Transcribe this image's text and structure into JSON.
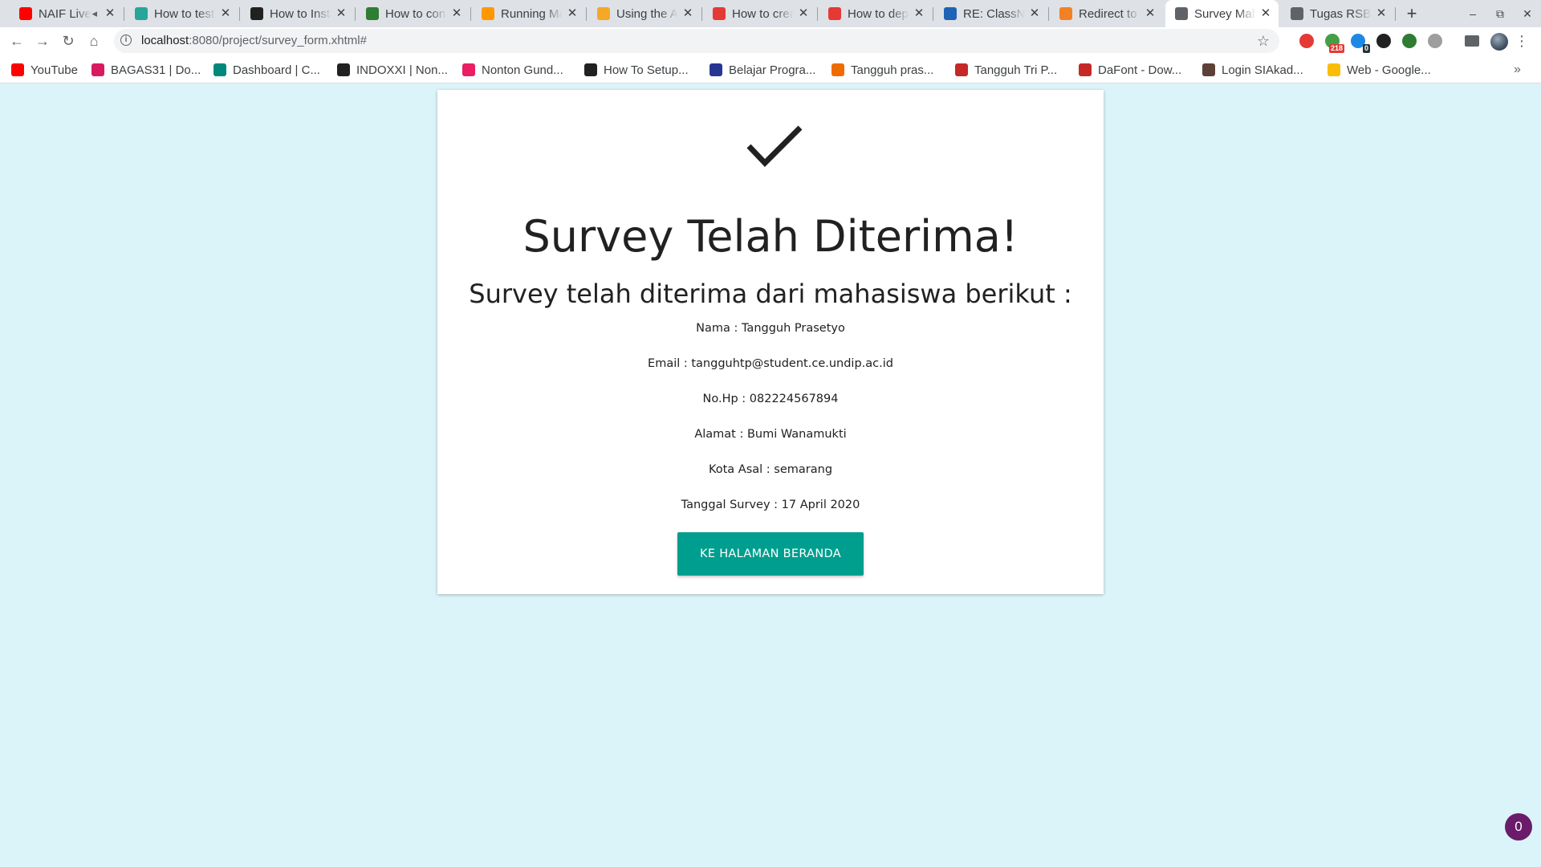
{
  "browser": {
    "tabs": [
      {
        "title": "NAIF Live",
        "favicon": "youtube-icon",
        "color": "#ff0000",
        "has_audio": true
      },
      {
        "title": "How to test",
        "favicon": "wave-icon",
        "color": "#26a69a"
      },
      {
        "title": "How to Install",
        "favicon": "hexagon-icon",
        "color": "#212121"
      },
      {
        "title": "How to con",
        "favicon": "bootstrap-icon",
        "color": "#2e7d32"
      },
      {
        "title": "Running Ma",
        "favicon": "zeta-icon",
        "color": "#ff9800"
      },
      {
        "title": "Using the A",
        "favicon": "box-icon",
        "color": "#f4a825"
      },
      {
        "title": "How to crea",
        "favicon": "javatpoint-icon",
        "color": "#e53935"
      },
      {
        "title": "How to dep",
        "favicon": "javatpoint-icon",
        "color": "#e53935"
      },
      {
        "title": "RE: ClassNo",
        "favicon": "forum-icon",
        "color": "#1e63b5"
      },
      {
        "title": "Redirect to",
        "favicon": "stackoverflow-icon",
        "color": "#f48024"
      },
      {
        "title": "Survey Mah",
        "favicon": "globe-icon",
        "color": "#5f6368",
        "active": true
      },
      {
        "title": "Tugas RSBK",
        "favicon": "globe-icon",
        "color": "#5f6368"
      }
    ],
    "new_tab_label": "+",
    "address": {
      "host": "localhost",
      "rest": ":8080/project/survey_form.xhtml#"
    },
    "extensions": [
      {
        "name": "color-wheel-icon",
        "color": "#e53935"
      },
      {
        "name": "calendar-icon",
        "color": "#43a047",
        "badge": "218",
        "badge_color": "#e53935"
      },
      {
        "name": "ghost-icon",
        "color": "#1e88e5",
        "badge": "0",
        "badge_color": "#263238"
      },
      {
        "name": "squirrel-icon",
        "color": "#212121"
      },
      {
        "name": "globe-green-icon",
        "color": "#2e7d32"
      },
      {
        "name": "circle-gray-icon",
        "color": "#9e9e9e"
      },
      {
        "name": "reading-list-icon",
        "color": "#5f6368"
      }
    ],
    "bookmarks": [
      {
        "label": "YouTube",
        "favicon": "youtube-icon",
        "color": "#ff0000"
      },
      {
        "label": "BAGAS31 | Do...",
        "favicon": "bagas-icon",
        "color": "#d81b60"
      },
      {
        "label": "Dashboard | C...",
        "favicon": "c-icon",
        "color": "#00897b"
      },
      {
        "label": "INDOXXI | Non...",
        "favicon": "indoxxi-icon",
        "color": "#212121"
      },
      {
        "label": "Nonton Gund...",
        "favicon": "gundam-icon",
        "color": "#e91e63"
      },
      {
        "label": "How To Setup...",
        "favicon": "s-icon",
        "color": "#212121"
      },
      {
        "label": "Belajar Progra...",
        "favicon": "book-icon",
        "color": "#283593"
      },
      {
        "label": "Tangguh pras...",
        "favicon": "ring-icon",
        "color": "#ef6c00"
      },
      {
        "label": "Tangguh Tri P...",
        "favicon": "diamond-icon",
        "color": "#c62828"
      },
      {
        "label": "DaFont - Dow...",
        "favicon": "dafont-icon",
        "color": "#c62828"
      },
      {
        "label": "Login SIAkad...",
        "favicon": "university-icon",
        "color": "#5d4037"
      },
      {
        "label": "Web - Google...",
        "favicon": "drive-icon",
        "color": "#fbbc04"
      }
    ]
  },
  "page": {
    "title": "Survey Telah Diterima!",
    "subtitle": "Survey telah diterima dari mahasiswa berikut :",
    "details": [
      "Nama : Tangguh Prasetyo",
      "Email : tangguhtp@student.ce.undip.ac.id",
      "No.Hp : 082224567894",
      "Alamat : Bumi Wanamukti",
      "Kota Asal : semarang",
      "Tanggal Survey : 17 April 2020"
    ],
    "button_label": "KE HALAMAN BERANDA",
    "accent_color": "#009e8e",
    "background_color": "#dbf4f9",
    "notification_count": "0"
  }
}
